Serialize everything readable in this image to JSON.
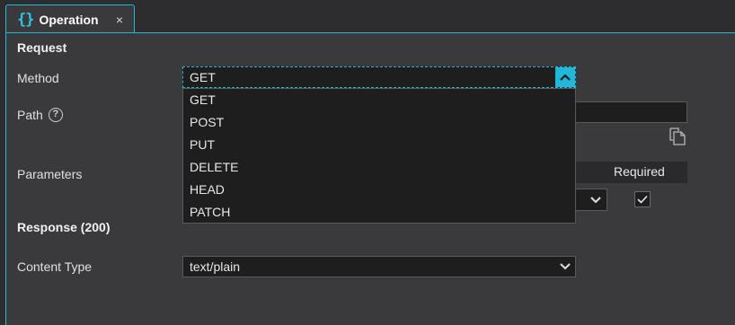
{
  "tab": {
    "icon": "{}",
    "title": "Operation",
    "close": "×"
  },
  "request": {
    "heading": "Request",
    "method_label": "Method",
    "method_value": "GET",
    "method_options": [
      "GET",
      "POST",
      "PUT",
      "DELETE",
      "HEAD",
      "PATCH"
    ],
    "path_label": "Path",
    "path_help": "?",
    "path_value": "",
    "parameters_label": "Parameters",
    "required_header": "Required",
    "required_checked": true
  },
  "response": {
    "heading": "Response (200)",
    "content_type_label": "Content Type",
    "content_type_value": "text/plain"
  },
  "colors": {
    "accent": "#1fb8d8",
    "panel": "#3a3a3d",
    "field": "#1e1e1e"
  },
  "icons": [
    "braces-icon",
    "close-icon",
    "help-icon",
    "chevron-up-icon",
    "chevron-down-icon",
    "copy-icon",
    "checkmark-icon"
  ]
}
